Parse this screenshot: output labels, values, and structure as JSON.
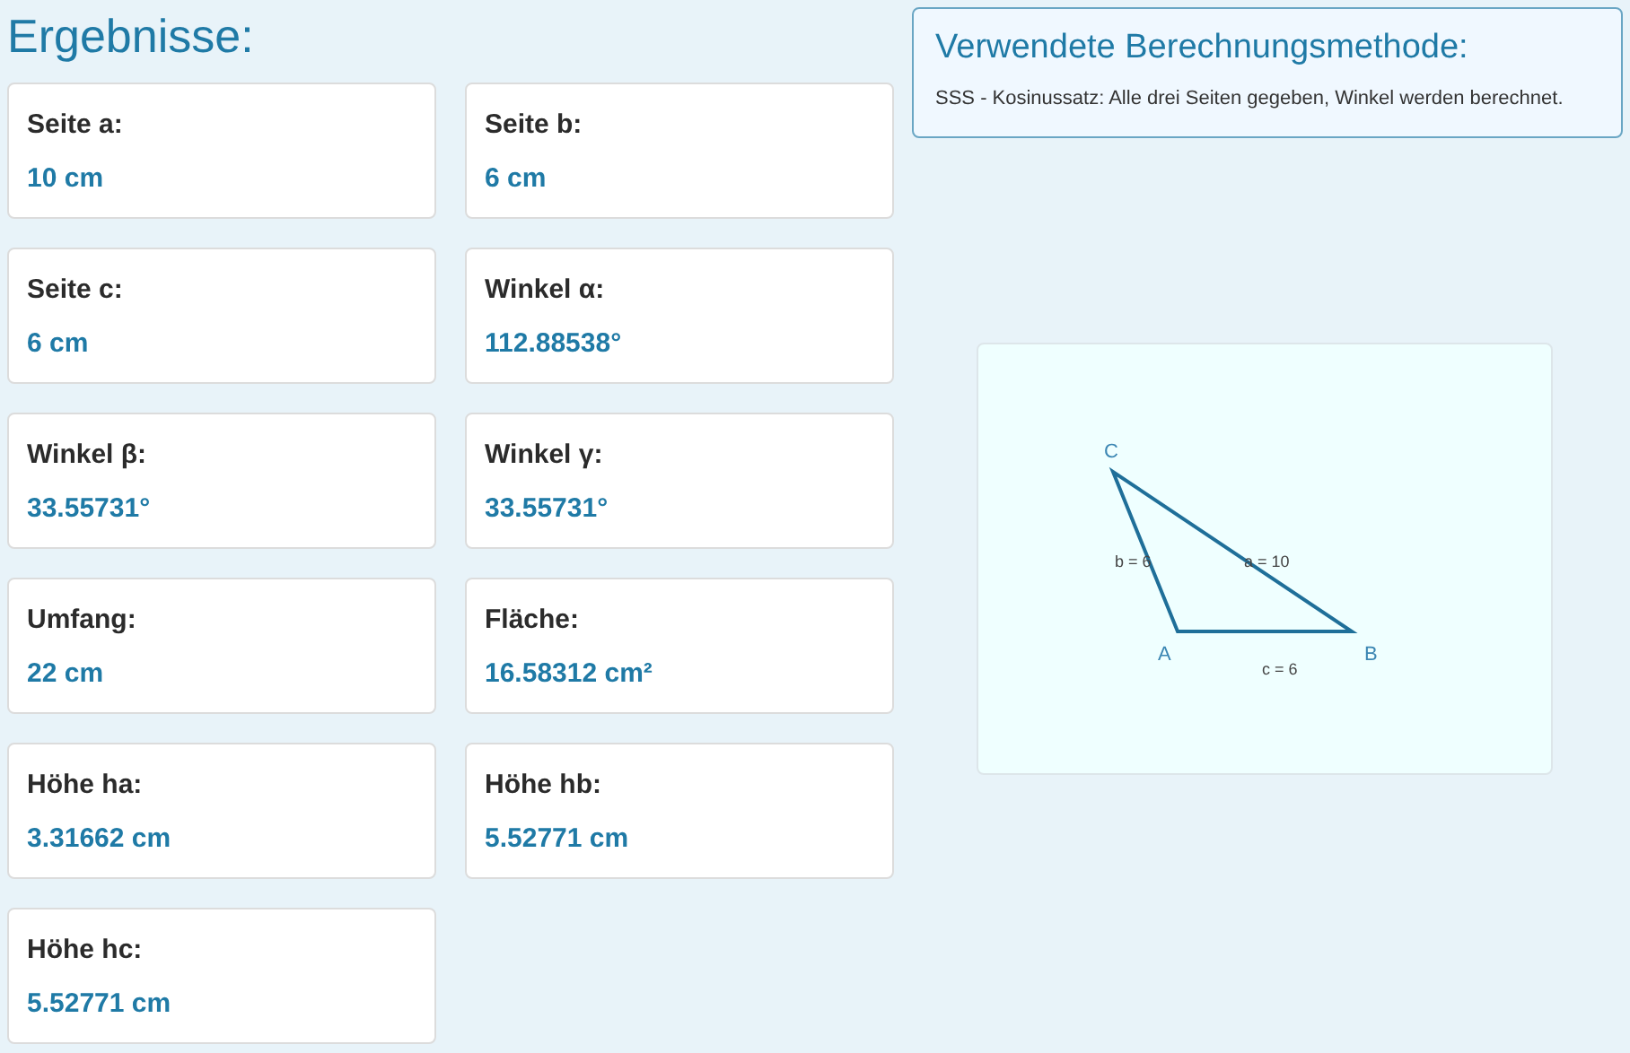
{
  "title": "Ergebnisse:",
  "results": [
    {
      "label": "Seite a:",
      "value": "10 cm"
    },
    {
      "label": "Seite b:",
      "value": "6 cm"
    },
    {
      "label": "Seite c:",
      "value": "6 cm"
    },
    {
      "label": "Winkel α:",
      "value": "112.88538°"
    },
    {
      "label": "Winkel β:",
      "value": "33.55731°"
    },
    {
      "label": "Winkel γ:",
      "value": "33.55731°"
    },
    {
      "label": "Umfang:",
      "value": "22 cm"
    },
    {
      "label": "Fläche:",
      "value": "16.58312 cm²"
    },
    {
      "label": "Höhe ha:",
      "value": "3.31662 cm"
    },
    {
      "label": "Höhe hb:",
      "value": "5.52771 cm"
    },
    {
      "label": "Höhe hc:",
      "value": "5.52771 cm"
    }
  ],
  "method": {
    "heading": "Verwendete Berechnungsmethode:",
    "text": "SSS - Kosinussatz: Alle drei Seiten gegeben, Winkel werden berechnet."
  },
  "diagram": {
    "vertices": [
      "A",
      "B",
      "C"
    ],
    "side_labels": [
      "a = 10",
      "b = 6",
      "c = 6"
    ]
  }
}
